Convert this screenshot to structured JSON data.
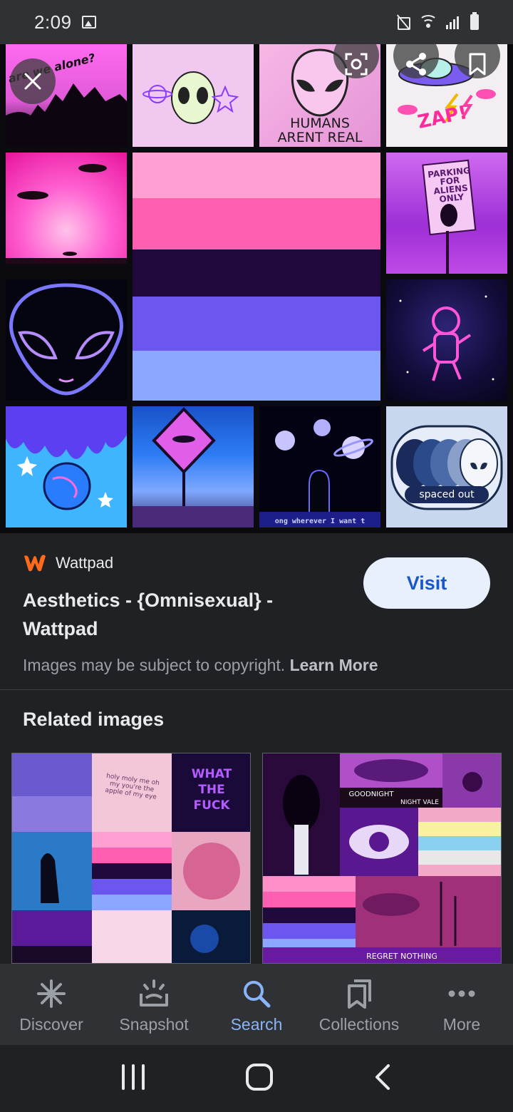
{
  "status_bar": {
    "time": "2:09",
    "icons": [
      "gallery-icon",
      "mute-icon",
      "wifi-icon",
      "signal-icon",
      "battery-icon"
    ]
  },
  "viewer": {
    "overlay_buttons": [
      "close-icon",
      "lens-icon",
      "share-icon",
      "bookmark-icon"
    ],
    "tile_texts": {
      "are_we_alone": "are we alone?",
      "humans": "HUMANS",
      "arent_real": "ARENT REAL",
      "zap": "ZAP!",
      "parking_sign": "PARKING FOR ALIENS ONLY",
      "spaced_out": "spaced out",
      "wherever": "ong wherever I want t"
    },
    "flag_colors": [
      "#ff9fd2",
      "#ff5fb0",
      "#22093d",
      "#6b57f0",
      "#8da6ff"
    ]
  },
  "result": {
    "source_name": "Wattpad",
    "title": "Aesthetics - {Omnisexual} - Wattpad",
    "visit_label": "Visit",
    "copyright_text": "Images may be subject to copyright.",
    "learn_more": "Learn More",
    "brand_color": "#ff6a1a"
  },
  "related": {
    "title": "Related images",
    "card1_texts": {
      "note": "holy moly me oh my you're the apple of my eye",
      "neon": "WHAT THE FUCK"
    },
    "card2_texts": {
      "goodnight": "GOODNIGHT",
      "night_vale": "NIGHT VALE",
      "regret": "REGRET NOTHING"
    }
  },
  "bottom_nav": {
    "items": [
      {
        "label": "Discover",
        "icon": "asterisk-icon"
      },
      {
        "label": "Snapshot",
        "icon": "snapshot-icon"
      },
      {
        "label": "Search",
        "icon": "search-icon"
      },
      {
        "label": "Collections",
        "icon": "collections-icon"
      },
      {
        "label": "More",
        "icon": "more-icon"
      }
    ],
    "active": "Search",
    "active_color": "#8ab4f8"
  },
  "system_nav": [
    "recent-apps-icon",
    "home-icon",
    "back-icon"
  ]
}
